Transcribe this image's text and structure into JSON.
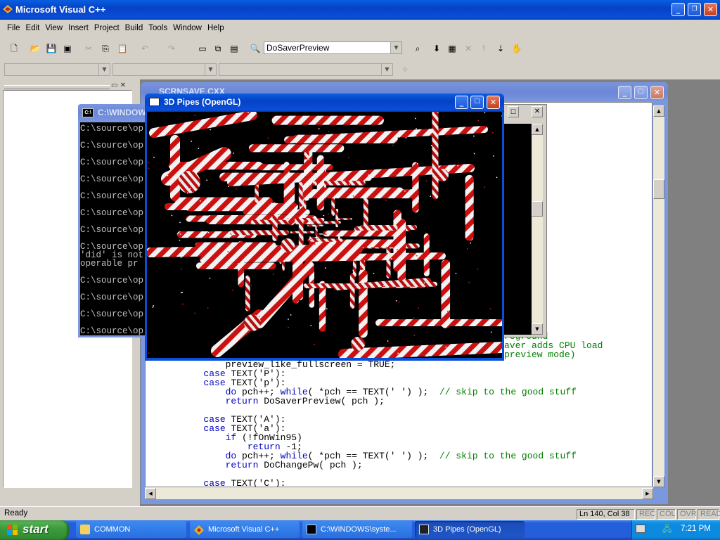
{
  "app": {
    "title": "Microsoft Visual C++",
    "menu": [
      "File",
      "Edit",
      "View",
      "Insert",
      "Project",
      "Build",
      "Tools",
      "Window",
      "Help"
    ],
    "config_combo": "DoSaverPreview"
  },
  "source_window": {
    "title": "SCRNSAVE.CXX",
    "code_lines": [
      {
        "indent": "            ",
        "parts": [
          {
            "t": "preview_like_fullscreen = TRUE;",
            "c": ""
          }
        ]
      },
      {
        "indent": "        ",
        "parts": [
          {
            "t": "case",
            "c": "kw"
          },
          {
            "t": " TEXT('P'):",
            "c": ""
          }
        ]
      },
      {
        "indent": "        ",
        "parts": [
          {
            "t": "case",
            "c": "kw"
          },
          {
            "t": " TEXT('p'):",
            "c": ""
          }
        ]
      },
      {
        "indent": "            ",
        "parts": [
          {
            "t": "do",
            "c": "kw"
          },
          {
            "t": " pch++; ",
            "c": ""
          },
          {
            "t": "while",
            "c": "kw"
          },
          {
            "t": "( *pch == TEXT(' ') );  ",
            "c": ""
          },
          {
            "t": "// skip to the good stuff",
            "c": "cm"
          }
        ]
      },
      {
        "indent": "            ",
        "parts": [
          {
            "t": "return",
            "c": "kw"
          },
          {
            "t": " DoSaverPreview( pch );",
            "c": ""
          }
        ]
      },
      {
        "indent": "",
        "parts": []
      },
      {
        "indent": "        ",
        "parts": [
          {
            "t": "case",
            "c": "kw"
          },
          {
            "t": " TEXT('A'):",
            "c": ""
          }
        ]
      },
      {
        "indent": "        ",
        "parts": [
          {
            "t": "case",
            "c": "kw"
          },
          {
            "t": " TEXT('a'):",
            "c": ""
          }
        ]
      },
      {
        "indent": "            ",
        "parts": [
          {
            "t": "if",
            "c": "kw"
          },
          {
            "t": " (!fOnWin95)",
            "c": ""
          }
        ]
      },
      {
        "indent": "                ",
        "parts": [
          {
            "t": "return",
            "c": "kw"
          },
          {
            "t": " -1;",
            "c": ""
          }
        ]
      },
      {
        "indent": "            ",
        "parts": [
          {
            "t": "do",
            "c": "kw"
          },
          {
            "t": " pch++; ",
            "c": ""
          },
          {
            "t": "while",
            "c": "kw"
          },
          {
            "t": "( *pch == TEXT(' ') );  ",
            "c": ""
          },
          {
            "t": "// skip to the good stuff",
            "c": "cm"
          }
        ]
      },
      {
        "indent": "            ",
        "parts": [
          {
            "t": "return",
            "c": "kw"
          },
          {
            "t": " DoChangePw( pch );",
            "c": ""
          }
        ]
      },
      {
        "indent": "",
        "parts": []
      },
      {
        "indent": "        ",
        "parts": [
          {
            "t": "case",
            "c": "kw"
          },
          {
            "t": " TEXT('C'):",
            "c": ""
          }
        ]
      }
    ],
    "partial_right": [
      {
        "text": "rs",
        "color": "#008000"
      },
      {
        "text": "reground",
        "color": "#008000"
      },
      {
        "text": "aver adds CPU load",
        "color": "#008000"
      },
      {
        "text": "preview mode)",
        "color": "#008000"
      }
    ]
  },
  "console_window": {
    "title": "C:\\WINDOW",
    "lines": [
      "C:\\source\\op",
      "",
      "C:\\source\\op",
      "",
      "C:\\source\\op",
      "",
      "C:\\source\\op",
      "",
      "C:\\source\\op",
      "",
      "C:\\source\\op",
      "",
      "C:\\source\\op",
      "",
      "C:\\source\\op",
      "'did' is not",
      "operable pr",
      "",
      "C:\\source\\op",
      "",
      "C:\\source\\op",
      "",
      "C:\\source\\op",
      "",
      "C:\\source\\op"
    ]
  },
  "pipes_window": {
    "title": "3D Pipes (OpenGL)"
  },
  "status_bar": {
    "text": "Ready",
    "position": "Ln 140, Col 38",
    "indicators": [
      "REC",
      "COL",
      "OVR",
      "READ"
    ]
  },
  "taskbar": {
    "start_label": "start",
    "buttons": [
      {
        "label": "COMMON",
        "icon": "folder-icon"
      },
      {
        "label": "Microsoft Visual C++",
        "icon": "vc-icon"
      },
      {
        "label": "C:\\WINDOWS\\syste...",
        "icon": "console-icon"
      },
      {
        "label": "3D Pipes (OpenGL)",
        "icon": "pipes-icon"
      }
    ],
    "clock": "7:21 PM"
  },
  "colors": {
    "xp_blue": "#0a4fd8",
    "taskbar": "#245edb",
    "start_green": "#3c9c3c",
    "pipe_red": "#cc1010"
  }
}
